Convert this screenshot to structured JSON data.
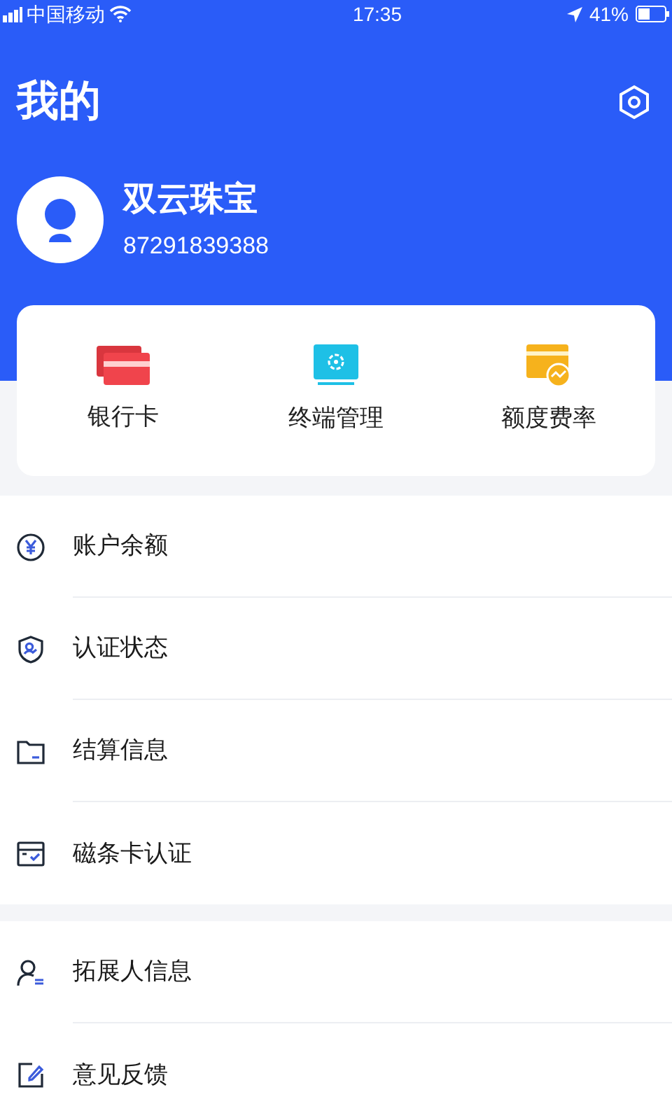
{
  "status_bar": {
    "carrier": "中国移动",
    "time": "17:35",
    "battery": "41%"
  },
  "header": {
    "title": "我的"
  },
  "profile": {
    "name": "双云珠宝",
    "account": "87291839388"
  },
  "shortcuts": [
    {
      "kind": "cards",
      "label": "银行卡"
    },
    {
      "kind": "terminal",
      "label": "终端管理"
    },
    {
      "kind": "rate",
      "label": "额度费率"
    }
  ],
  "menu_groups": [
    [
      {
        "kind": "yuan",
        "label": "账户余额"
      },
      {
        "kind": "shield",
        "label": "认证状态"
      },
      {
        "kind": "folder",
        "label": "结算信息"
      },
      {
        "kind": "card",
        "label": "磁条卡认证"
      }
    ],
    [
      {
        "kind": "person",
        "label": "拓展人信息"
      },
      {
        "kind": "edit",
        "label": "意见反馈"
      }
    ]
  ]
}
